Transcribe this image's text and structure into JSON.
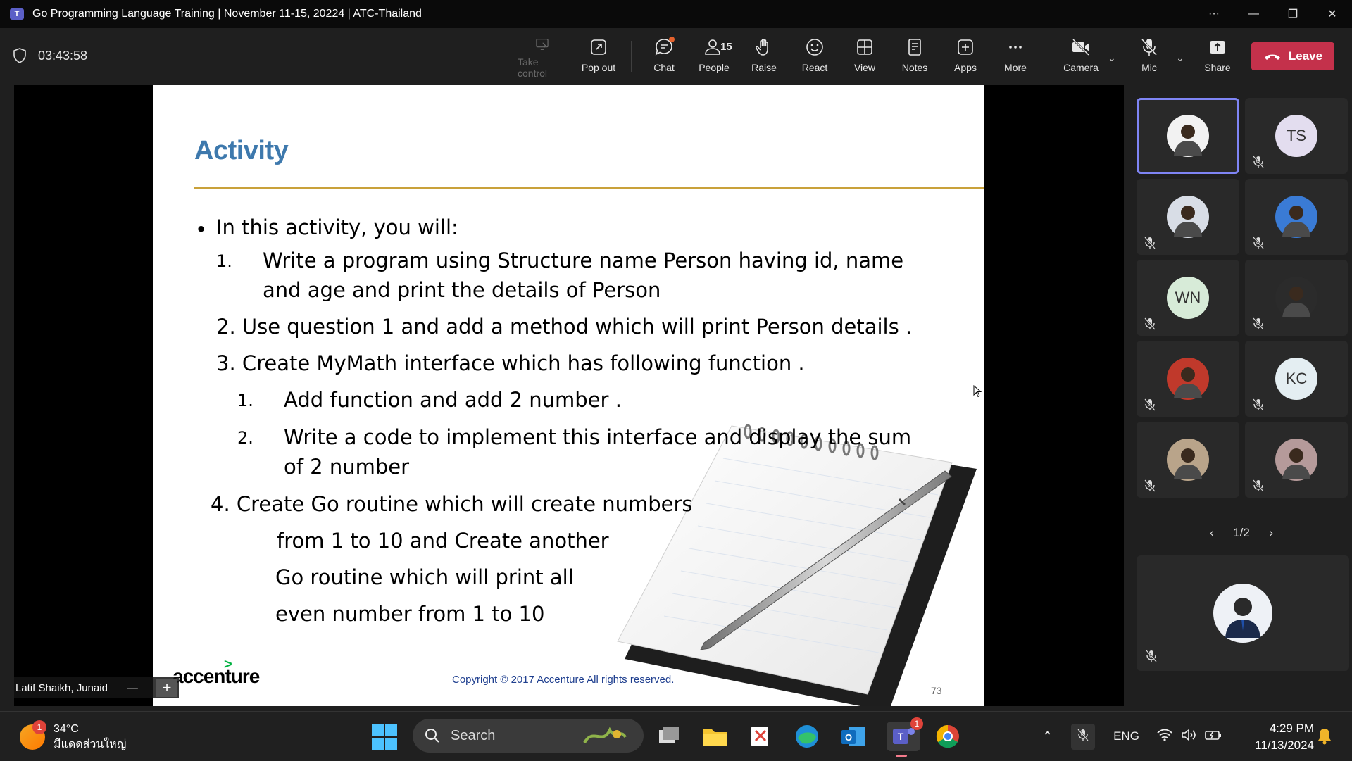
{
  "window": {
    "title": "Go Programming Language Training | November 11-15, 20224 | ATC-Thailand",
    "app_logo": "T"
  },
  "toolbar": {
    "timer": "03:43:58",
    "buttons": {
      "take_control": "Take control",
      "pop_out": "Pop out",
      "chat": "Chat",
      "people": "People",
      "people_count": "15",
      "raise": "Raise",
      "react": "React",
      "view": "View",
      "notes": "Notes",
      "apps": "Apps",
      "more": "More",
      "camera": "Camera",
      "mic": "Mic",
      "share": "Share",
      "leave": "Leave"
    }
  },
  "slide": {
    "title": "Activity",
    "bullet": "•",
    "intro": "In this activity, you will:",
    "items": [
      {
        "num": "1.",
        "line1": "Write a program using  Structure name Person having id, name",
        "line2": "and age and print the details of Person"
      },
      {
        "text": "2. Use question 1 and add a method which will print Person details ."
      },
      {
        "text": "3. Create MyMath interface which has following function ."
      },
      {
        "num": "1.",
        "line1": "Add function and add 2 number ."
      },
      {
        "num": "2.",
        "line1": "Write a code to implement this interface and display  the sum",
        "line2": "of  2 number"
      },
      {
        "text": "4. Create Go routine which  will create numbers"
      },
      {
        "text": "from 1 to 10 and Create another"
      },
      {
        "text": "Go routine which will print all"
      },
      {
        "text": "even number from 1 to 10"
      }
    ],
    "logo": "accenture",
    "copyright": "Copyright © 2017 Accenture  All rights reserved.",
    "page_number": "73"
  },
  "presenter": {
    "name": "Latif Shaikh, Junaid",
    "minus": "—",
    "plus": "+"
  },
  "participants": {
    "tiles": [
      {
        "initials": "",
        "color": "#f2f2f2"
      },
      {
        "initials": "TS",
        "color": "#e3ddef"
      },
      {
        "initials": "",
        "color": "#d8dde6"
      },
      {
        "initials": "",
        "color": "#3a7bd5"
      },
      {
        "initials": "WN",
        "color": "#d7ebd8"
      },
      {
        "initials": "",
        "color": "#2b2b2b"
      },
      {
        "initials": "",
        "color": "#c0392b"
      },
      {
        "initials": "KC",
        "color": "#e4eef2"
      },
      {
        "initials": "",
        "color": "#b9a48a"
      },
      {
        "initials": "",
        "color": "#b59a9a"
      }
    ],
    "page": "1/2",
    "prev": "‹",
    "next": "›"
  },
  "taskbar": {
    "weather_temp": "34°C",
    "weather_desc": "มีแดดส่วนใหญ่",
    "weather_badge": "1",
    "search_label": "Search",
    "teams_badge": "1",
    "language": "ENG",
    "time": "4:29 PM",
    "date": "11/13/2024"
  }
}
